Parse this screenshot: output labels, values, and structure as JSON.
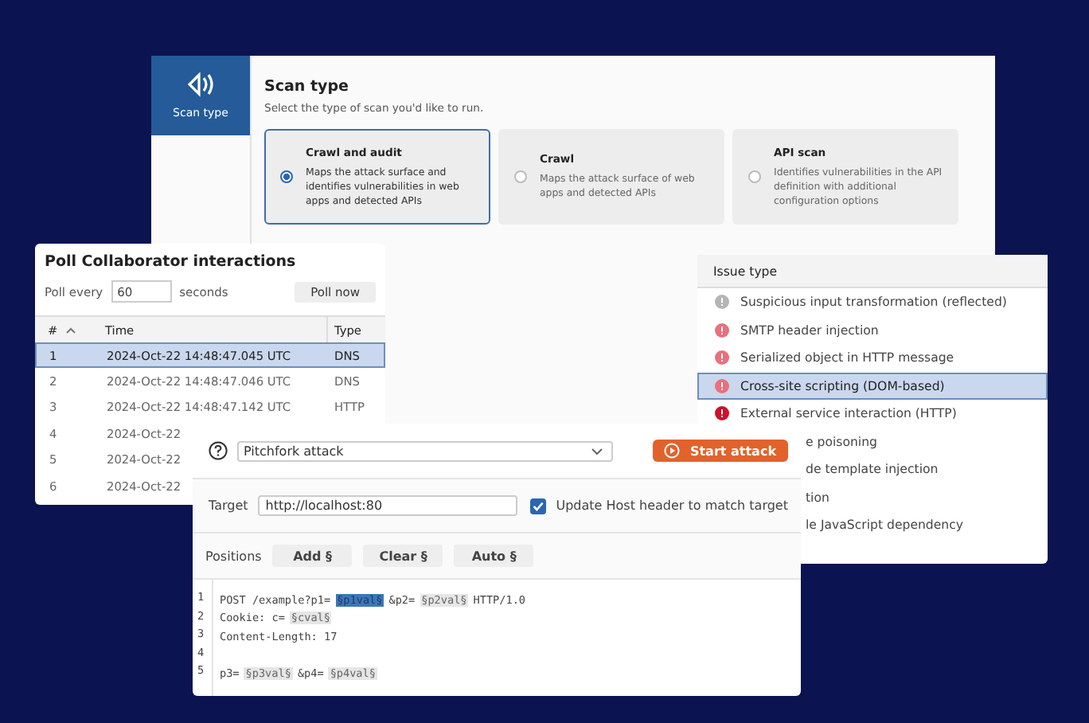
{
  "scan_window": {
    "nav": {
      "label": "Scan type",
      "selected": true
    },
    "title": "Scan type",
    "subtitle": "Select the type of scan you'd like to run.",
    "options": [
      {
        "title": "Crawl and audit",
        "description": "Maps the attack surface and identifies vulnerabilities in web apps and detected APIs",
        "selected": true
      },
      {
        "title": "Crawl",
        "description": "Maps the attack surface of web apps and detected APIs",
        "selected": false
      },
      {
        "title": "API scan",
        "description": "Identifies vulnerabilities in the API definition with additional configuration options",
        "selected": false
      }
    ]
  },
  "poll_window": {
    "title": "Poll Collaborator interactions",
    "poll_label": "Poll every",
    "interval": "60",
    "unit": "seconds",
    "button": "Poll now",
    "columns": [
      "#",
      "Time",
      "Type"
    ],
    "rows": [
      {
        "number": "1",
        "time": "2024-Oct-22 14:48:47.045 UTC",
        "type": "DNS",
        "selected": true
      },
      {
        "number": "2",
        "time": "2024-Oct-22 14:48:47.046 UTC",
        "type": "DNS",
        "selected": false
      },
      {
        "number": "3",
        "time": "2024-Oct-22 14:48:47.142 UTC",
        "type": "HTTP",
        "selected": false
      },
      {
        "number": "4",
        "time": "2024-Oct-22",
        "selected": false
      },
      {
        "number": "5",
        "time": "2024-Oct-22",
        "selected": false
      },
      {
        "number": "6",
        "time": "2024-Oct-22",
        "selected": false
      }
    ]
  },
  "issues": {
    "header": "Issue type",
    "items": [
      {
        "label": "Suspicious input transformation (reflected)",
        "color": "#b5b5b5",
        "selected": false
      },
      {
        "label": "SMTP header injection",
        "color": "#e9707f",
        "selected": false
      },
      {
        "label": "Serialized object in HTTP message",
        "color": "#e9707f",
        "selected": false
      },
      {
        "label": "Cross-site scripting (DOM-based)",
        "color": "#e9707f",
        "selected": true
      },
      {
        "label": "External service interaction (HTTP)",
        "color": "#d0112b",
        "selected": false
      },
      {
        "label": "e poisoning",
        "selected": false
      },
      {
        "label": "de template injection",
        "selected": false
      },
      {
        "label": "tion",
        "selected": false
      },
      {
        "label": "le JavaScript dependency",
        "selected": false
      }
    ]
  },
  "intruder": {
    "attack_type": "Pitchfork attack",
    "start_button": "Start attack",
    "target_label": "Target",
    "target": "http://localhost:80",
    "update_host": {
      "label": "Update Host header to match target",
      "checked": true
    },
    "positions_label": "Positions",
    "buttons": [
      "Add §",
      "Clear §",
      "Auto §"
    ],
    "lines": [
      {
        "number": "1",
        "segments": [
          {
            "kind": "plain",
            "text": "POST /example?p1="
          },
          {
            "kind": "marker",
            "text": "§p1val§",
            "selected": true
          },
          {
            "kind": "plain",
            "text": "&p2="
          },
          {
            "kind": "marker",
            "text": "§p2val§",
            "selected": false
          },
          {
            "kind": "plain",
            "text": "HTTP/1.0"
          }
        ]
      },
      {
        "number": "2",
        "segments": [
          {
            "kind": "plain",
            "text": "Cookie: c="
          },
          {
            "kind": "marker",
            "text": "§cval§",
            "selected": false
          }
        ]
      },
      {
        "number": "3",
        "segments": [
          {
            "kind": "plain",
            "text": "Content-Length: 17"
          }
        ]
      },
      {
        "number": "4"
      },
      {
        "number": "5",
        "segments": [
          {
            "kind": "plain",
            "text": "p3="
          },
          {
            "kind": "marker",
            "text": "§p3val§",
            "selected": false
          },
          {
            "kind": "plain",
            "text": "&p4="
          },
          {
            "kind": "marker",
            "text": "§p4val§",
            "selected": false
          }
        ]
      }
    ]
  }
}
